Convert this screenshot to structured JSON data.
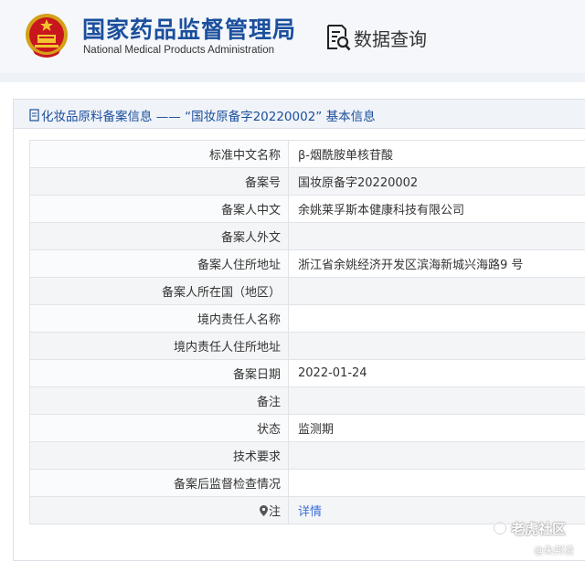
{
  "header": {
    "brand_cn": "国家药品监督管理局",
    "brand_en": "National Medical Products Administration",
    "query_label": "数据查询",
    "emblem_icon": "national-emblem-icon",
    "query_icon": "document-search-icon",
    "brand_color": "#1b4f9c"
  },
  "panel": {
    "title": "化妆品原料备案信息 —— “国妆原备字20220002” 基本信息",
    "title_icon": "document-icon"
  },
  "rows": [
    {
      "label": "标准中文名称",
      "value": "β-烟酰胺单核苷酸"
    },
    {
      "label": "备案号",
      "value": "国妆原备字20220002"
    },
    {
      "label": "备案人中文",
      "value": "余姚莱孚斯本健康科技有限公司"
    },
    {
      "label": "备案人外文",
      "value": ""
    },
    {
      "label": "备案人住所地址",
      "value": "浙江省余姚经济开发区滨海新城兴海路9 号"
    },
    {
      "label": "备案人所在国（地区）",
      "value": ""
    },
    {
      "label": "境内责任人名称",
      "value": ""
    },
    {
      "label": "境内责任人住所地址",
      "value": ""
    },
    {
      "label": "备案日期",
      "value": "2022-01-24"
    },
    {
      "label": "备注",
      "value": ""
    },
    {
      "label": "状态",
      "value": "监测期"
    },
    {
      "label": "技术要求",
      "value": ""
    },
    {
      "label": "备案后监督检查情况",
      "value": ""
    },
    {
      "label": "注",
      "value": "详情",
      "icon": "location-pin-icon"
    }
  ],
  "watermark": {
    "text": "老虎社区",
    "author": "@朱邦凌"
  },
  "colors": {
    "link": "#3a6ed6",
    "header_bg": "#f5f7fb",
    "title_bar_bg": "#f0f3f8"
  }
}
